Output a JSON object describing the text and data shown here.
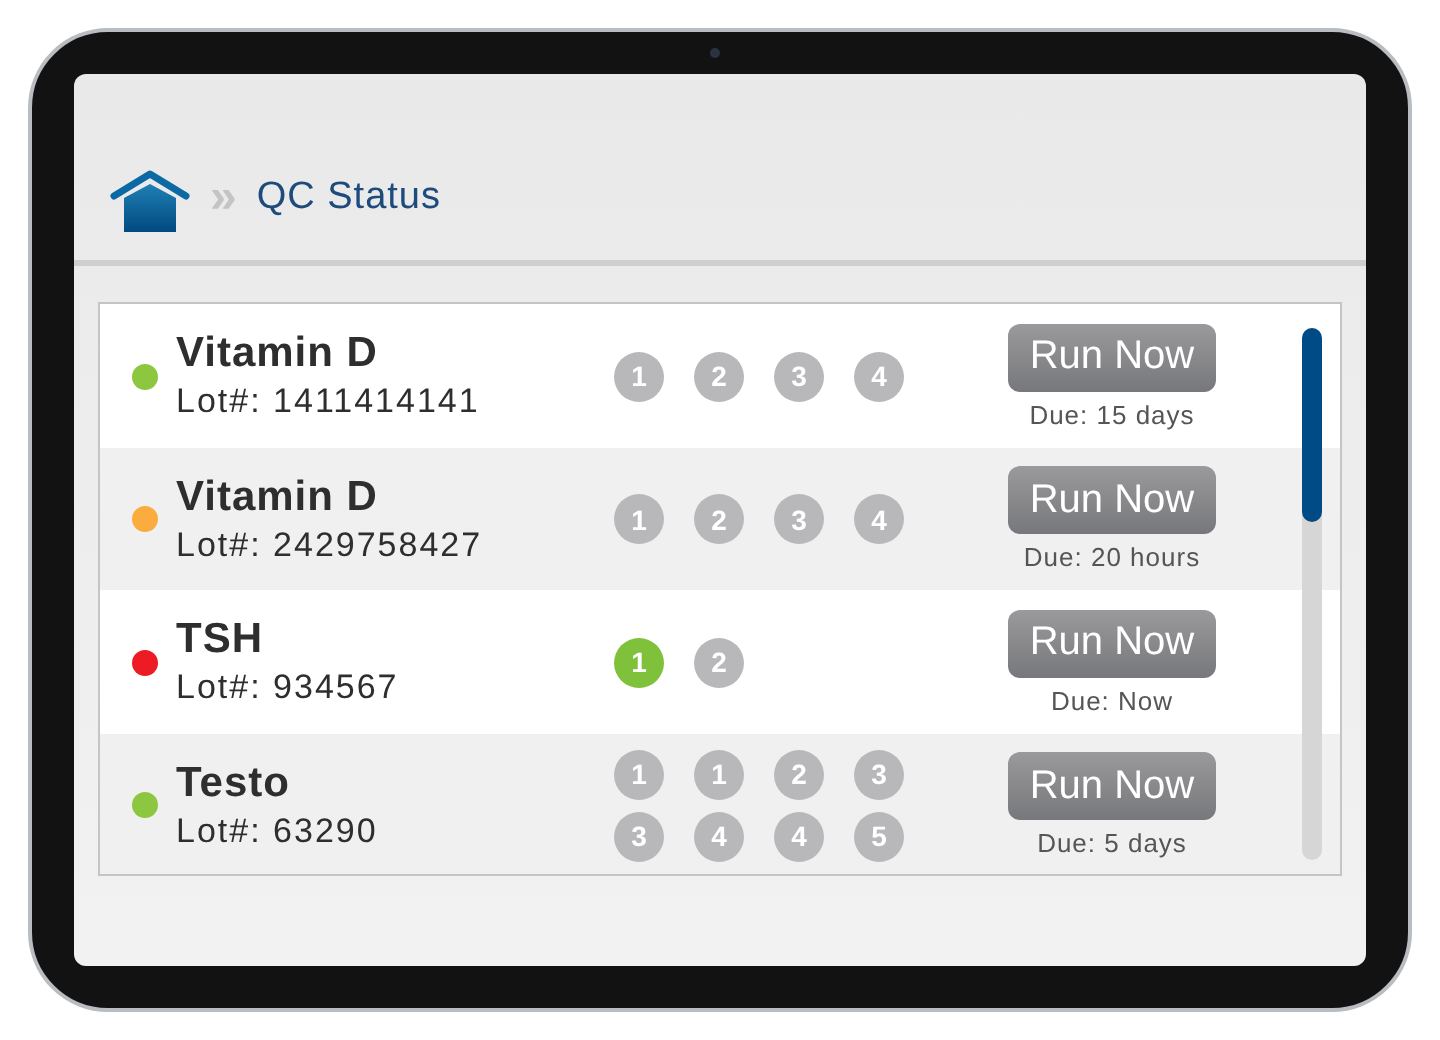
{
  "breadcrumb": {
    "separator": "»",
    "title": "QC Status"
  },
  "tests": [
    {
      "name": "Vitamin D",
      "lot": "Lot#: 1411414141",
      "color": "#8dc63f",
      "levels": [
        {
          "label": "1",
          "passed": false
        },
        {
          "label": "2",
          "passed": false
        },
        {
          "label": "3",
          "passed": false
        },
        {
          "label": "4",
          "passed": false
        }
      ],
      "button": "Run Now",
      "due": "Due: 15 days"
    },
    {
      "name": "Vitamin D",
      "lot": "Lot#: 2429758427",
      "color": "#fbac3f",
      "levels": [
        {
          "label": "1",
          "passed": false
        },
        {
          "label": "2",
          "passed": false
        },
        {
          "label": "3",
          "passed": false
        },
        {
          "label": "4",
          "passed": false
        }
      ],
      "button": "Run Now",
      "due": "Due: 20 hours"
    },
    {
      "name": "TSH",
      "lot": "Lot#: 934567",
      "color": "#ed1c24",
      "levels": [
        {
          "label": "1",
          "passed": true
        },
        {
          "label": "2",
          "passed": false
        }
      ],
      "button": "Run Now",
      "due": "Due: Now"
    },
    {
      "name": "Testo",
      "lot": "Lot#: 63290",
      "color": "#8dc63f",
      "levels": [
        {
          "label": "1",
          "passed": false
        },
        {
          "label": "1",
          "passed": false
        },
        {
          "label": "2",
          "passed": false
        },
        {
          "label": "3",
          "passed": false
        },
        {
          "label": "3",
          "passed": false
        },
        {
          "label": "4",
          "passed": false
        },
        {
          "label": "4",
          "passed": false
        },
        {
          "label": "5",
          "passed": false
        }
      ],
      "button": "Run Now",
      "due": "Due: 5 days"
    }
  ]
}
